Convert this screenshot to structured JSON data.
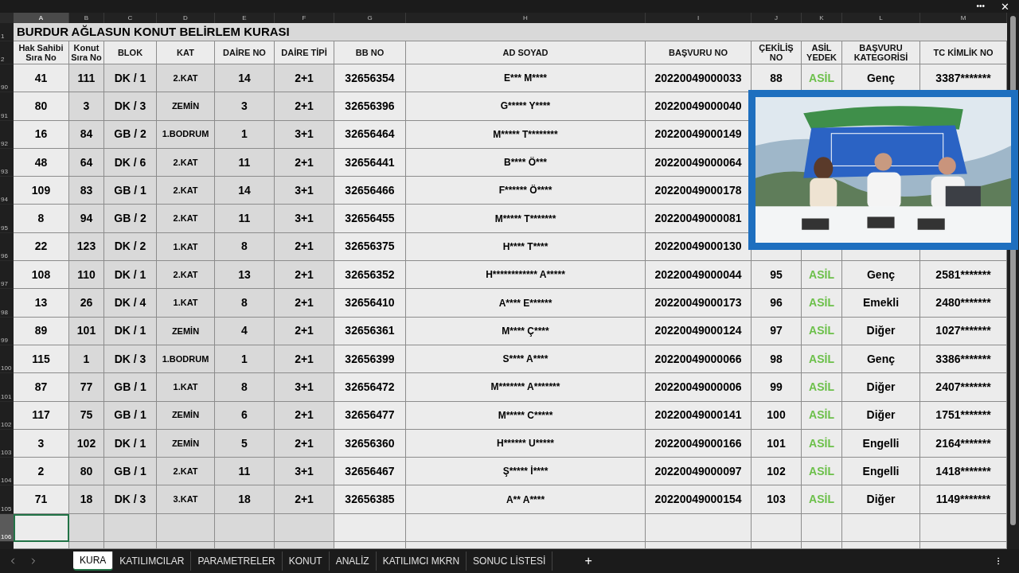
{
  "window": {
    "more": "•••",
    "close": "✕"
  },
  "columns": [
    {
      "letter": "A",
      "selected": true
    },
    {
      "letter": "B",
      "selected": false
    },
    {
      "letter": "C",
      "selected": false
    },
    {
      "letter": "D",
      "selected": false
    },
    {
      "letter": "E",
      "selected": false
    },
    {
      "letter": "F",
      "selected": false
    },
    {
      "letter": "G",
      "selected": false
    },
    {
      "letter": "H",
      "selected": false
    },
    {
      "letter": "I",
      "selected": false
    },
    {
      "letter": "J",
      "selected": false
    },
    {
      "letter": "K",
      "selected": false
    },
    {
      "letter": "L",
      "selected": false
    },
    {
      "letter": "M",
      "selected": false
    }
  ],
  "title_row": {
    "row_number": "1",
    "title": "BURDUR AĞLASUN KONUT BELİRLEM KURASI"
  },
  "header_row": {
    "row_number": "2",
    "headers": [
      "Hak Sahibi Sıra No",
      "Konut Sıra No",
      "BLOK",
      "KAT",
      "DAİRE NO",
      "DAİRE TİPİ",
      "BB NO",
      "AD SOYAD",
      "BAŞVURU NO",
      "ÇEKİLİŞ NO",
      "ASİL YEDEK",
      "BAŞVURU KATEGORİSİ",
      "TC KİMLİK NO"
    ]
  },
  "rows": [
    {
      "row_number": "90",
      "selected": false,
      "cells": [
        "41",
        "111",
        "DK / 1",
        "2.KAT",
        "14",
        "2+1",
        "32656354",
        "E*** M****",
        "20220049000033",
        "88",
        "ASİL",
        "Genç",
        "3387*******"
      ]
    },
    {
      "row_number": "91",
      "selected": false,
      "cells": [
        "80",
        "3",
        "DK / 3",
        "ZEMİN",
        "3",
        "2+1",
        "32656396",
        "G***** Y****",
        "20220049000040"
      ]
    },
    {
      "row_number": "92",
      "selected": false,
      "cells": [
        "16",
        "84",
        "GB / 2",
        "1.BODRUM",
        "1",
        "3+1",
        "32656464",
        "M***** T********",
        "20220049000149"
      ]
    },
    {
      "row_number": "93",
      "selected": false,
      "cells": [
        "48",
        "64",
        "DK / 6",
        "2.KAT",
        "11",
        "2+1",
        "32656441",
        "B**** Ö***",
        "20220049000064"
      ]
    },
    {
      "row_number": "94",
      "selected": false,
      "cells": [
        "109",
        "83",
        "GB / 1",
        "2.KAT",
        "14",
        "3+1",
        "32656466",
        "F****** Ö****",
        "20220049000178"
      ]
    },
    {
      "row_number": "95",
      "selected": false,
      "cells": [
        "8",
        "94",
        "GB / 2",
        "2.KAT",
        "11",
        "3+1",
        "32656455",
        "M***** T*******",
        "20220049000081"
      ]
    },
    {
      "row_number": "96",
      "selected": false,
      "cells": [
        "22",
        "123",
        "DK / 2",
        "1.KAT",
        "8",
        "2+1",
        "32656375",
        "H**** T****",
        "20220049000130"
      ]
    },
    {
      "row_number": "97",
      "selected": false,
      "cells": [
        "108",
        "110",
        "DK / 1",
        "2.KAT",
        "13",
        "2+1",
        "32656352",
        "H************ A*****",
        "20220049000044",
        "95",
        "ASİL",
        "Genç",
        "2581*******"
      ]
    },
    {
      "row_number": "98",
      "selected": false,
      "cells": [
        "13",
        "26",
        "DK / 4",
        "1.KAT",
        "8",
        "2+1",
        "32656410",
        "A**** E******",
        "20220049000173",
        "96",
        "ASİL",
        "Emekli",
        "2480*******"
      ]
    },
    {
      "row_number": "99",
      "selected": false,
      "cells": [
        "89",
        "101",
        "DK / 1",
        "ZEMİN",
        "4",
        "2+1",
        "32656361",
        "M**** Ç****",
        "20220049000124",
        "97",
        "ASİL",
        "Diğer",
        "1027*******"
      ]
    },
    {
      "row_number": "100",
      "selected": false,
      "cells": [
        "115",
        "1",
        "DK / 3",
        "1.BODRUM",
        "1",
        "2+1",
        "32656399",
        "S**** A****",
        "20220049000066",
        "98",
        "ASİL",
        "Genç",
        "3386*******"
      ]
    },
    {
      "row_number": "101",
      "selected": false,
      "cells": [
        "87",
        "77",
        "GB / 1",
        "1.KAT",
        "8",
        "3+1",
        "32656472",
        "M******* A*******",
        "20220049000006",
        "99",
        "ASİL",
        "Diğer",
        "2407*******"
      ]
    },
    {
      "row_number": "102",
      "selected": false,
      "cells": [
        "117",
        "75",
        "GB / 1",
        "ZEMİN",
        "6",
        "2+1",
        "32656477",
        "M***** C*****",
        "20220049000141",
        "100",
        "ASİL",
        "Diğer",
        "1751*******"
      ]
    },
    {
      "row_number": "103",
      "selected": false,
      "cells": [
        "3",
        "102",
        "DK / 1",
        "ZEMİN",
        "5",
        "2+1",
        "32656360",
        "H****** U*****",
        "20220049000166",
        "101",
        "ASİL",
        "Engelli",
        "2164*******"
      ]
    },
    {
      "row_number": "104",
      "selected": false,
      "cells": [
        "2",
        "80",
        "GB / 1",
        "2.KAT",
        "11",
        "3+1",
        "32656467",
        "Ş***** İ****",
        "20220049000097",
        "102",
        "ASİL",
        "Engelli",
        "1418*******"
      ]
    },
    {
      "row_number": "105",
      "selected": false,
      "cells": [
        "71",
        "18",
        "DK / 3",
        "3.KAT",
        "18",
        "2+1",
        "32656385",
        "A** A****",
        "20220049000154",
        "103",
        "ASİL",
        "Diğer",
        "1149*******"
      ]
    },
    {
      "row_number": "106",
      "selected": true,
      "cells": []
    }
  ],
  "sheet_tabs": [
    {
      "label": "KURA",
      "selected": true
    },
    {
      "label": "KATILIMCILAR",
      "selected": false
    },
    {
      "label": "PARAMETRELER",
      "selected": false
    },
    {
      "label": "KONUT",
      "selected": false
    },
    {
      "label": "ANALİZ",
      "selected": false
    },
    {
      "label": "KATILIMCI MKRN",
      "selected": false
    },
    {
      "label": "SONUC LİSTESİ",
      "selected": false
    }
  ],
  "add_sheet": "+"
}
